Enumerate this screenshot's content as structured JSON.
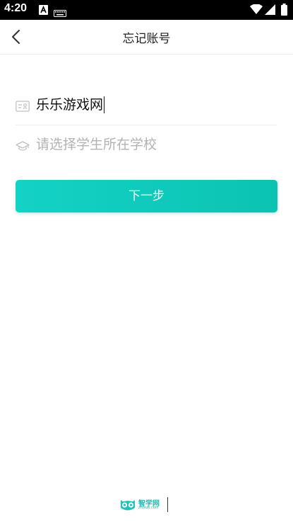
{
  "status_bar": {
    "time": "4:20",
    "icons": [
      "a-notification-icon",
      "keyboard-icon",
      "wifi-icon",
      "signal-icon",
      "battery-icon"
    ]
  },
  "header": {
    "title": "忘记账号",
    "back_icon": "chevron-left-icon"
  },
  "form": {
    "name_field": {
      "icon": "id-card-icon",
      "value": "乐乐游戏网"
    },
    "school_field": {
      "icon": "graduation-cap-icon",
      "placeholder": "请选择学生所在学校"
    }
  },
  "actions": {
    "next_label": "下一步"
  },
  "footer": {
    "logo_cn": "智学网",
    "logo_en": "zhixue.com"
  },
  "colors": {
    "accent": "#13d2c6",
    "accent_dark": "#0cc3b1",
    "placeholder": "#b3b3b3",
    "icon_gray": "#c2c2c2"
  }
}
